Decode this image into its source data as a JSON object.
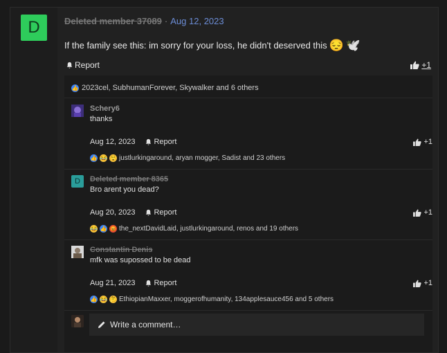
{
  "post": {
    "avatar_letter": "D",
    "author": "Deleted member 37089",
    "separator": "·",
    "date": "Aug 12, 2023",
    "text": "If the family see this: im sorry for your loss, he didn't deserved this",
    "emojis": [
      "😔",
      "🕊️"
    ],
    "report_label": "Report",
    "like_count": "+1",
    "reaction_summary": "2023cel, SubhumanForever, Skywalker and 6 others"
  },
  "comments": [
    {
      "author": "Schery6",
      "text": "thanks",
      "date": "Aug 12, 2023",
      "report_label": "Report",
      "like_count": "+1",
      "reactions": "justlurkingaround, aryan mogger, Sadist and 23 others"
    },
    {
      "avatar_letter": "D",
      "author": "Deleted member 8365",
      "text": "Bro arent you dead?",
      "date": "Aug 20, 2023",
      "report_label": "Report",
      "like_count": "+1",
      "reactions": "the_nextDavidLaid, justlurkingaround, renos and 19 others"
    },
    {
      "author": "Constantin Denis",
      "text": "mfk was supossed to be dead",
      "date": "Aug 21, 2023",
      "report_label": "Report",
      "like_count": "+1",
      "reactions": "EthiopianMaxxer, moggerofhumanity, 134applesauce456 and 5 others"
    }
  ],
  "write_comment": {
    "placeholder": "Write a comment…"
  },
  "colors": {
    "avatar_green": "#2ecc5b",
    "avatar_teal": "#2a9d9a",
    "link_blue": "#6c8dd6"
  }
}
